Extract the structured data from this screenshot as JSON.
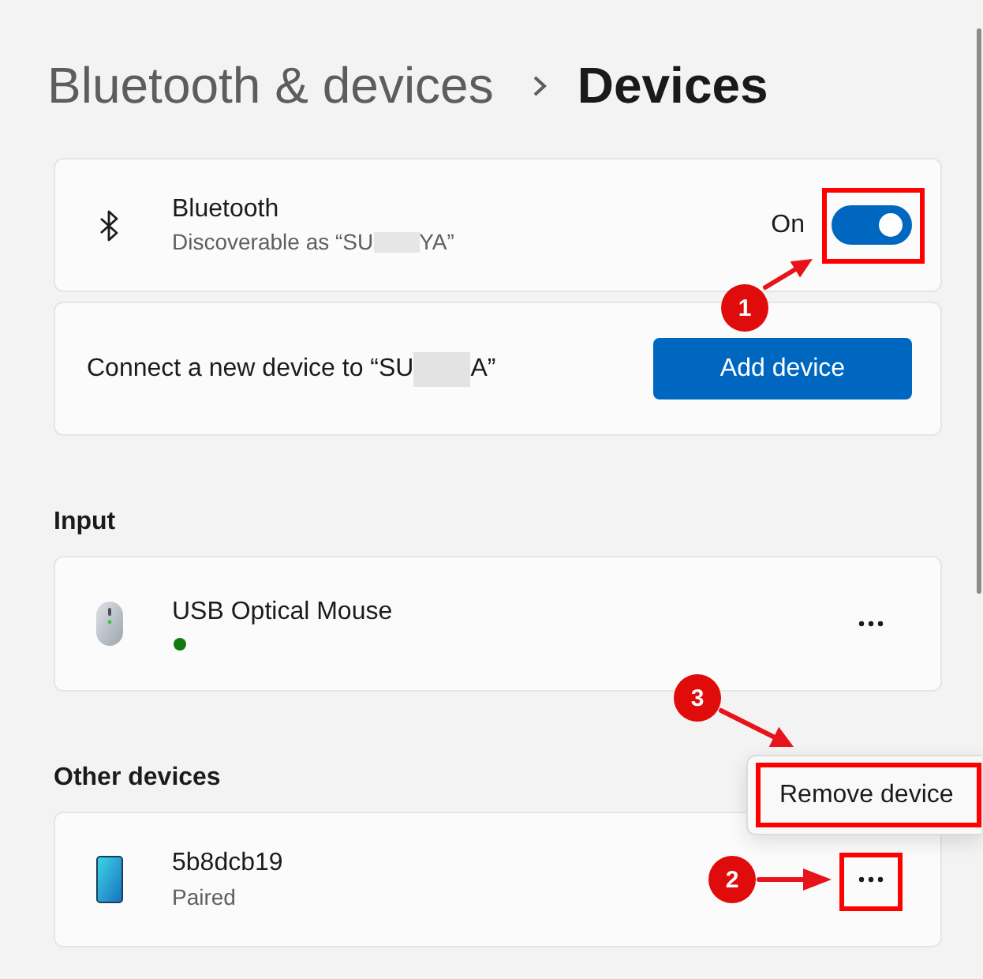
{
  "breadcrumb": [
    {
      "label": "Bluetooth & devices",
      "current": false
    },
    {
      "label": "Devices",
      "current": true
    }
  ],
  "bluetooth": {
    "title": "Bluetooth",
    "subtitle": [
      "Discoverable as “SU",
      "YA”"
    ],
    "state_label": "On",
    "on": true,
    "highlighted": true,
    "callout": "1"
  },
  "connect": {
    "text": [
      "Connect a new device to “SU",
      "A”"
    ],
    "button": "Add device"
  },
  "sections": [
    {
      "heading": "Input",
      "devices": [
        {
          "kind": "mouse",
          "name": "USB Optical Mouse",
          "connected": true,
          "highlighted": false
        }
      ]
    },
    {
      "heading": "Other devices",
      "devices": [
        {
          "kind": "phone",
          "name": "5b8dcb19",
          "status": "Paired",
          "connected": false,
          "highlighted": true,
          "callout": "2",
          "menu": {
            "items": [
              {
                "label": "Remove device",
                "highlighted": true,
                "callout": "3"
              }
            ]
          }
        }
      ]
    }
  ]
}
